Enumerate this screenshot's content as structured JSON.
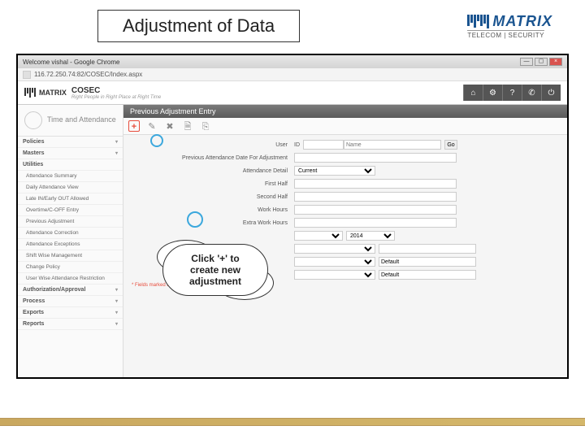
{
  "slide": {
    "title": "Adjustment of Data",
    "logo_brand": "MATRIX",
    "logo_sub": "TELECOM | SECURITY"
  },
  "browser": {
    "title": "Welcome vishal - Google Chrome",
    "url": "116.72.250.74:82/COSEC/Index.aspx"
  },
  "app": {
    "brand": "MATRIX",
    "product": "COSEC",
    "tagline": "Right People in Right Place at Right Time",
    "header_icons": {
      "home": "⌂",
      "settings": "⚙",
      "help": "?",
      "phone": "✆",
      "power": "⏻"
    }
  },
  "sidebar": {
    "module": "Time and Attendance",
    "sections": {
      "policies": "Policies",
      "masters": "Masters",
      "utilities": "Utilities"
    },
    "items": [
      "Attendance Summary",
      "Daily Attendance View",
      "Late IN/Early OUT Allowed",
      "Overtime/C-OFF Entry",
      "Previous Adjustment",
      "Attendance Correction",
      "Attendance Exceptions",
      "Shift Wise Management",
      "Change Policy",
      "User Wise Attendance Restriction"
    ],
    "bottom": {
      "auth": "Authorization/Approval",
      "process": "Process",
      "exports": "Exports",
      "reports": "Reports"
    }
  },
  "content": {
    "header": "Previous Adjustment Entry",
    "toolbar": {
      "plus": "+",
      "edit": "✎",
      "delete": "✖",
      "save": "🗎",
      "copy": "⎘"
    },
    "user_label": "User",
    "user_id_label": "ID",
    "user_name_placeholder": "Name",
    "go": "Go",
    "fields": {
      "prev_date": "Previous Attendance Date For Adjustment",
      "att_detail": "Attendance Detail",
      "att_detail_value": "Current",
      "first_half": "First Half",
      "second_half": "Second Half",
      "work_hours": "Work Hours",
      "extra_work": "Extra Work Hours",
      "year": "2014",
      "val_default": "Default",
      "footer_hint": "* Fields marked are compulsory"
    }
  },
  "callout": {
    "text_l1": "Click '+' to",
    "text_l2": "create new",
    "text_l3": "adjustment"
  }
}
